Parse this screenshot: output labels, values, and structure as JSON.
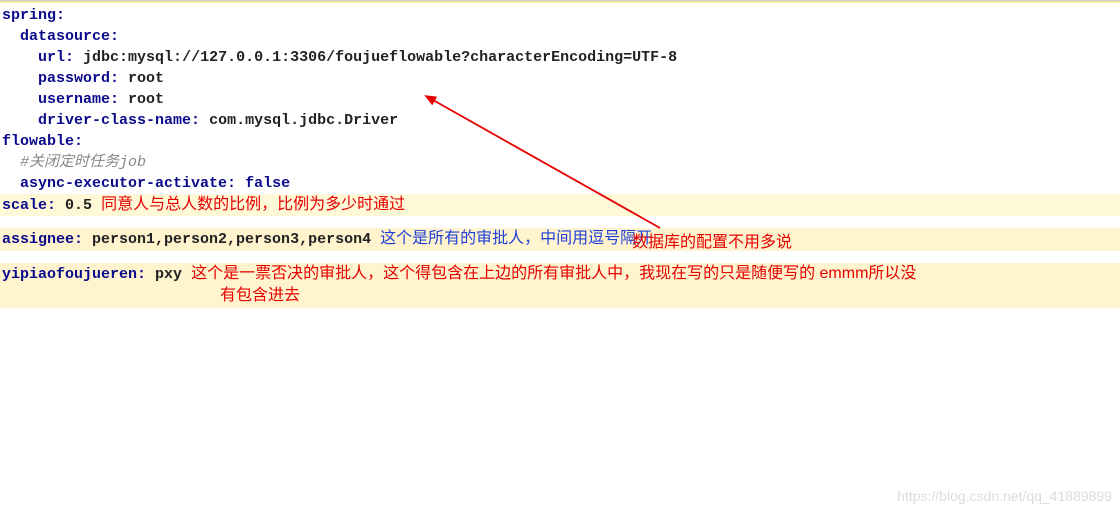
{
  "yaml": {
    "spring": {
      "label": "spring:",
      "datasource": {
        "label": "datasource:",
        "url": {
          "key": "url:",
          "value": "jdbc:mysql://127.0.0.1:3306/foujueflowable?characterEncoding=UTF-8"
        },
        "password": {
          "key": "password:",
          "value": "root"
        },
        "username": {
          "key": "username:",
          "value": "root"
        },
        "driver": {
          "key": "driver-class-name:",
          "value": "com.mysql.jdbc.Driver"
        }
      }
    },
    "flowable": {
      "label": "flowable:",
      "comment": "#关闭定时任务job",
      "async": {
        "key": "async-executor-activate:",
        "value": "false"
      }
    },
    "scale": {
      "key": "scale:",
      "value": "0.5"
    },
    "assignee": {
      "key": "assignee:",
      "value": "person1,person2,person3,person4"
    },
    "yipiao": {
      "key": "yipiaofoujueren:",
      "value": "pxy"
    }
  },
  "annotations": {
    "scale_note": "同意人与总人数的比例，比例为多少时通过",
    "db_note": "数据库的配置不用多说",
    "assignee_note": "这个是所有的审批人，中间用逗号隔开",
    "yipiao_note_line1": "这个是一票否决的审批人，这个得包含在上边的所有审批人中，我现在写的只是随便写的 emmm所以没",
    "yipiao_note_line2": "有包含进去"
  },
  "watermark": "https://blog.csdn.net/qq_41889899"
}
